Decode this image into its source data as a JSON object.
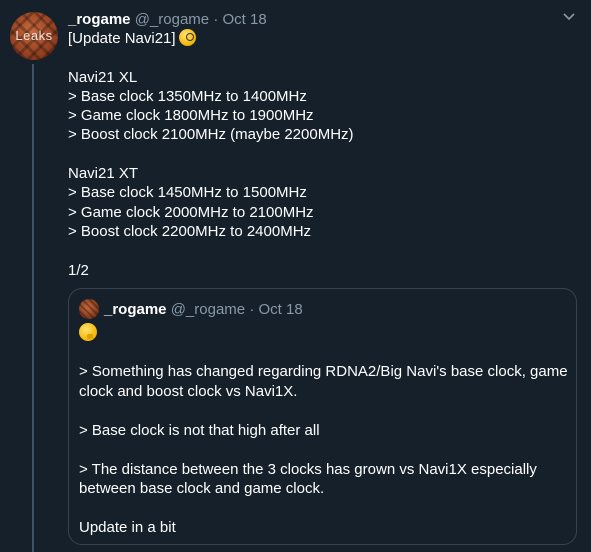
{
  "tweet": {
    "name": "_rogame",
    "handle": "@_rogame",
    "separator": "·",
    "date": "Oct 18",
    "avatar_text": "Leaks",
    "lines": [
      "[Update Navi21]",
      "",
      "Navi21 XL",
      "> Base clock 1350MHz to 1400MHz",
      "> Game clock 1800MHz to 1900MHz",
      "> Boost clock 2100MHz (maybe 2200MHz)",
      "",
      "Navi21 XT",
      "> Base clock 1450MHz to 1500MHz",
      "> Game clock 2000MHz to 2100MHz",
      "> Boost clock 2200MHz to 2400MHz",
      "",
      "1/2"
    ],
    "emoji": "face-with-monocle-icon"
  },
  "quote": {
    "name": "_rogame",
    "handle": "@_rogame",
    "separator": "·",
    "date": "Oct 18",
    "emoji": "thinking-face-icon",
    "paragraphs": [
      "> Something has changed regarding RDNA2/Big Navi's base clock, game clock and boost clock vs Navi1X.",
      "> Base clock is not that high after all",
      "> The distance between the 3 clocks has grown vs Navi1X especially between base clock and game clock.",
      "Update in a bit"
    ]
  },
  "colors": {
    "background": "#15202b",
    "text": "#ffffff",
    "secondary": "#8899a6",
    "border": "#38444d"
  }
}
